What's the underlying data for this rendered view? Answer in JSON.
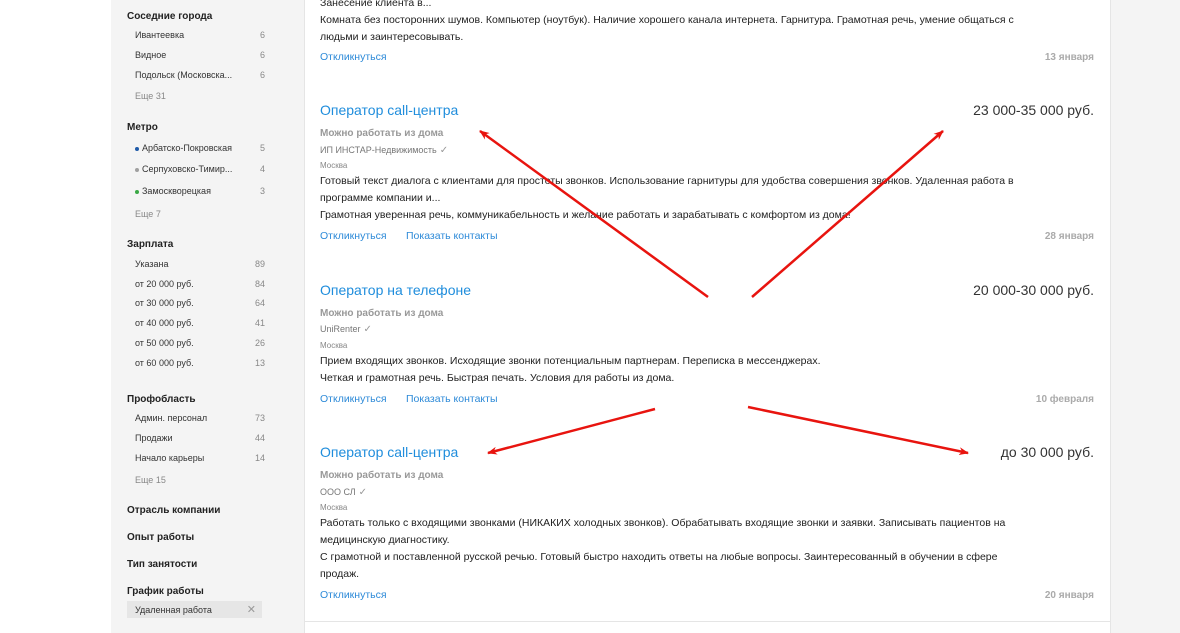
{
  "sidebar": {
    "groups": [
      {
        "title": "Соседние города",
        "items": [
          {
            "label": "Ивантеевка",
            "count": "6"
          },
          {
            "label": "Видное",
            "count": "6"
          },
          {
            "label": "Подольск (Московска...",
            "count": "6"
          }
        ],
        "more": "Еще 31"
      },
      {
        "title": "Метро",
        "items": [
          {
            "label": "Арбатско-Покровская",
            "count": "5",
            "color": "#1f5aa8"
          },
          {
            "label": "Серпуховско-Тимир...",
            "count": "4",
            "color": "#a0a0a0"
          },
          {
            "label": "Замоскворецкая",
            "count": "3",
            "color": "#3aa845"
          }
        ],
        "more": "Еще 7"
      },
      {
        "title": "Зарплата",
        "items": [
          {
            "label": "Указана",
            "count": "89"
          },
          {
            "label": "от 20 000 руб.",
            "count": "84"
          },
          {
            "label": "от 30 000 руб.",
            "count": "64"
          },
          {
            "label": "от 40 000 руб.",
            "count": "41"
          },
          {
            "label": "от 50 000 руб.",
            "count": "26"
          },
          {
            "label": "от 60 000 руб.",
            "count": "13"
          }
        ]
      },
      {
        "title": "Профобласть",
        "items": [
          {
            "label": "Админ. персонал",
            "count": "73"
          },
          {
            "label": "Продажи",
            "count": "44"
          },
          {
            "label": "Начало карьеры",
            "count": "14"
          }
        ],
        "more": "Еще 15"
      }
    ],
    "collapsed": [
      "Отрасль компании",
      "Опыт работы",
      "Тип занятости",
      "График работы"
    ],
    "chip": {
      "label": "Удаленная работа",
      "close": "✕"
    }
  },
  "vacancies": [
    {
      "desc_lines": [
        "Занесение клиента в...",
        "Комната без посторонних шумов. Компьютер (ноутбук). Наличие хорошего канала интернета. Гарнитура. Грамотная речь, умение общаться с",
        "людьми и заинтересовывать."
      ],
      "respond": "Откликнуться",
      "date": "13 января"
    },
    {
      "title": "Оператор call-центра",
      "salary": "23 000-35 000 руб.",
      "remote": "Можно работать из дома",
      "company": "ИП ИНСТАР-Недвижимость",
      "city": "Москва",
      "desc_lines": [
        "Готовый текст диалога с клиентами для простоты звонков. Использование гарнитуры для удобства совершения звонков. Удаленная работа в",
        "программе компании и...",
        "Грамотная уверенная речь, коммуникабельность и желание работать и зарабатывать с комфортом из дома!"
      ],
      "respond": "Откликнуться",
      "contacts": "Показать контакты",
      "date": "28 января"
    },
    {
      "title": "Оператор на телефоне",
      "salary": "20 000-30 000 руб.",
      "remote": "Можно работать из дома",
      "company": "UniRenter",
      "city": "Москва",
      "desc_lines": [
        "Прием входящих звонков. Исходящие звонки потенциальным партнерам. Переписка в мессенджерах.",
        "Четкая и грамотная речь. Быстрая печать. Условия для работы из дома."
      ],
      "respond": "Откликнуться",
      "contacts": "Показать контакты",
      "date": "10 февраля"
    },
    {
      "title": "Оператор call-центра",
      "salary": "до 30 000 руб.",
      "remote": "Можно работать из дома",
      "company": "ООО СЛ",
      "city": "Москва",
      "desc_lines": [
        "Работать только с входящими звонками (НИКАКИХ холодных звонков). Обрабатывать входящие звонки и заявки. Записывать пациентов на",
        "медицинскую диагностику.",
        "С грамотной и поставленной русской речью. Готовый быстро находить ответы на любые вопросы. Заинтересованный в обучении в сфере",
        "продаж."
      ],
      "respond": "Откликнуться",
      "date": "20 января"
    }
  ],
  "colors": {
    "accent": "#1f8ddc",
    "arrow": "#e8140f"
  },
  "check_icon": "check-icon"
}
